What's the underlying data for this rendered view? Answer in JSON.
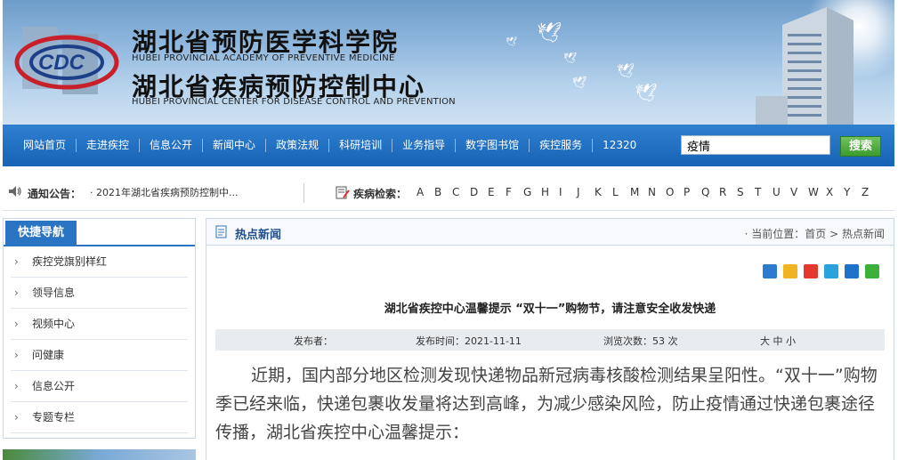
{
  "header": {
    "title_cn_1": "湖北省预防医学科学院",
    "title_en_1": "HUBEI PROVINCIAL ACADEMY OF PREVENTIVE MEDICINE",
    "title_cn_2": "湖北省疾病预防控制中心",
    "title_en_2": "HUBEI PROVINCIAL CENTER FOR DISEASE CONTROL AND PREVENTION",
    "logo_text": "CDC"
  },
  "nav": {
    "items": [
      "网站首页",
      "走进疾控",
      "信息公开",
      "新闻中心",
      "政策法规",
      "科研培训",
      "业务指导",
      "数字图书馆",
      "疾控服务",
      "12320"
    ],
    "search_value": "疫情",
    "search_button": "搜索"
  },
  "notice": {
    "label": "通知公告：",
    "text": "· 2021年湖北省疾病预防控制中...",
    "disease_label": "疾病检索：",
    "letters": [
      "A",
      "B",
      "C",
      "D",
      "E",
      "F",
      "G",
      "H",
      "I",
      "J",
      "K",
      "L",
      "M",
      "N",
      "O",
      "P",
      "Q",
      "R",
      "S",
      "T",
      "U",
      "V",
      "W",
      "X",
      "Y",
      "Z"
    ]
  },
  "sidebar": {
    "title": "快捷导航",
    "items": [
      "疾控党旗别样红",
      "领导信息",
      "视频中心",
      "问健康",
      "信息公开",
      "专题专栏"
    ]
  },
  "main": {
    "section_title": "热点新闻",
    "breadcrumb": "· 当前位置：首页 > 热点新闻",
    "article_title": "湖北省疾控中心温馨提示  “双十一”购物节，请注意安全收发快递",
    "meta": {
      "publisher": "发布者：",
      "date": "发布时间：2021-11-11",
      "views": "浏览次数：53 次",
      "size": "大 中 小"
    },
    "body": "近期，国内部分地区检测发现快递物品新冠病毒核酸检测结果呈阳性。“双十一”购物季已经来临，快递包裹收发量将达到高峰，为减少感染风险，防止疫情通过快递包裹途径传播，湖北省疾控中心温馨提示："
  },
  "share_icons": [
    "share-plus-icon",
    "qzone-icon",
    "weibo-icon",
    "tencent-weibo-icon",
    "renren-icon",
    "wechat-icon"
  ],
  "colors": {
    "nav_blue": "#1e6bc0",
    "sidebar_accent": "#2a74c4",
    "search_green": "#4aa83a"
  }
}
